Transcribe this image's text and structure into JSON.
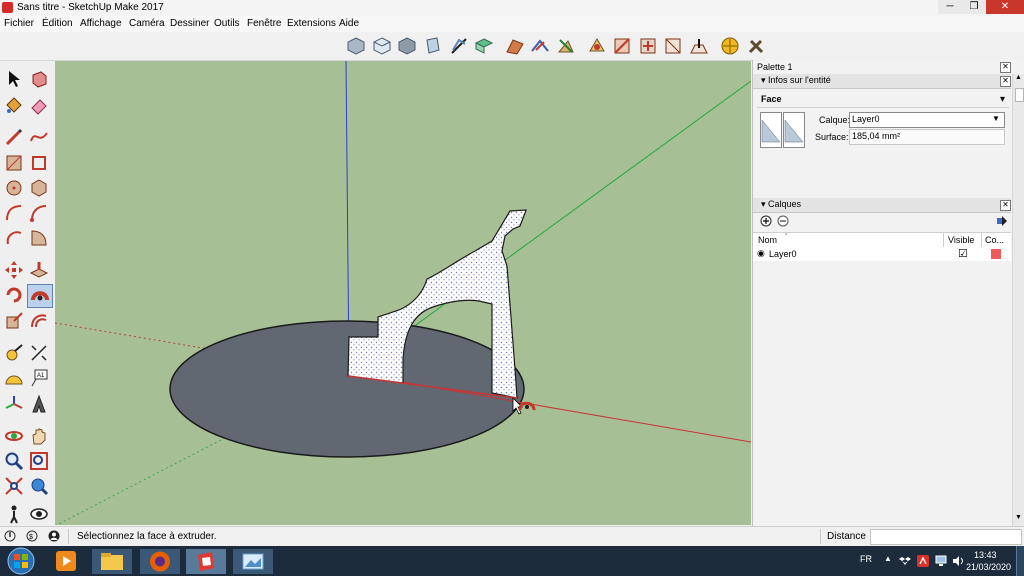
{
  "window": {
    "title": "Sans titre - SketchUp Make 2017",
    "min": "─",
    "max": "❐",
    "close": "✕"
  },
  "menu": [
    "Fichier",
    "Édition",
    "Affichage",
    "Caméra",
    "Dessiner",
    "Outils",
    "Fenêtre",
    "Extensions",
    "Aide"
  ],
  "palette": {
    "title": "Palette 1",
    "entity": {
      "header": "Infos sur l'entité",
      "type": "Face",
      "layer_label": "Calque:",
      "layer_value": "Layer0",
      "surface_label": "Surface:",
      "surface_value": "185,04 mm²"
    },
    "layers": {
      "header": "Calques",
      "columns": {
        "name": "Nom",
        "visible": "Visible",
        "color": "Co..."
      },
      "rows": [
        {
          "name": "Layer0",
          "visible": "☑",
          "color": "#f05a5a"
        }
      ]
    }
  },
  "status": {
    "message": "Sélectionnez la face à extruder.",
    "measure_label": "Distance",
    "measure_value": ""
  },
  "taskbar": {
    "lang": "FR",
    "time": "13:43",
    "date": "21/03/2020"
  },
  "colors": {
    "ground": "#a7bf94",
    "disc": "#616872",
    "axis_red": "#cc3333",
    "axis_green": "#2aa83a",
    "axis_blue": "#2a3fd0",
    "layer_color": "#f05a5a"
  }
}
